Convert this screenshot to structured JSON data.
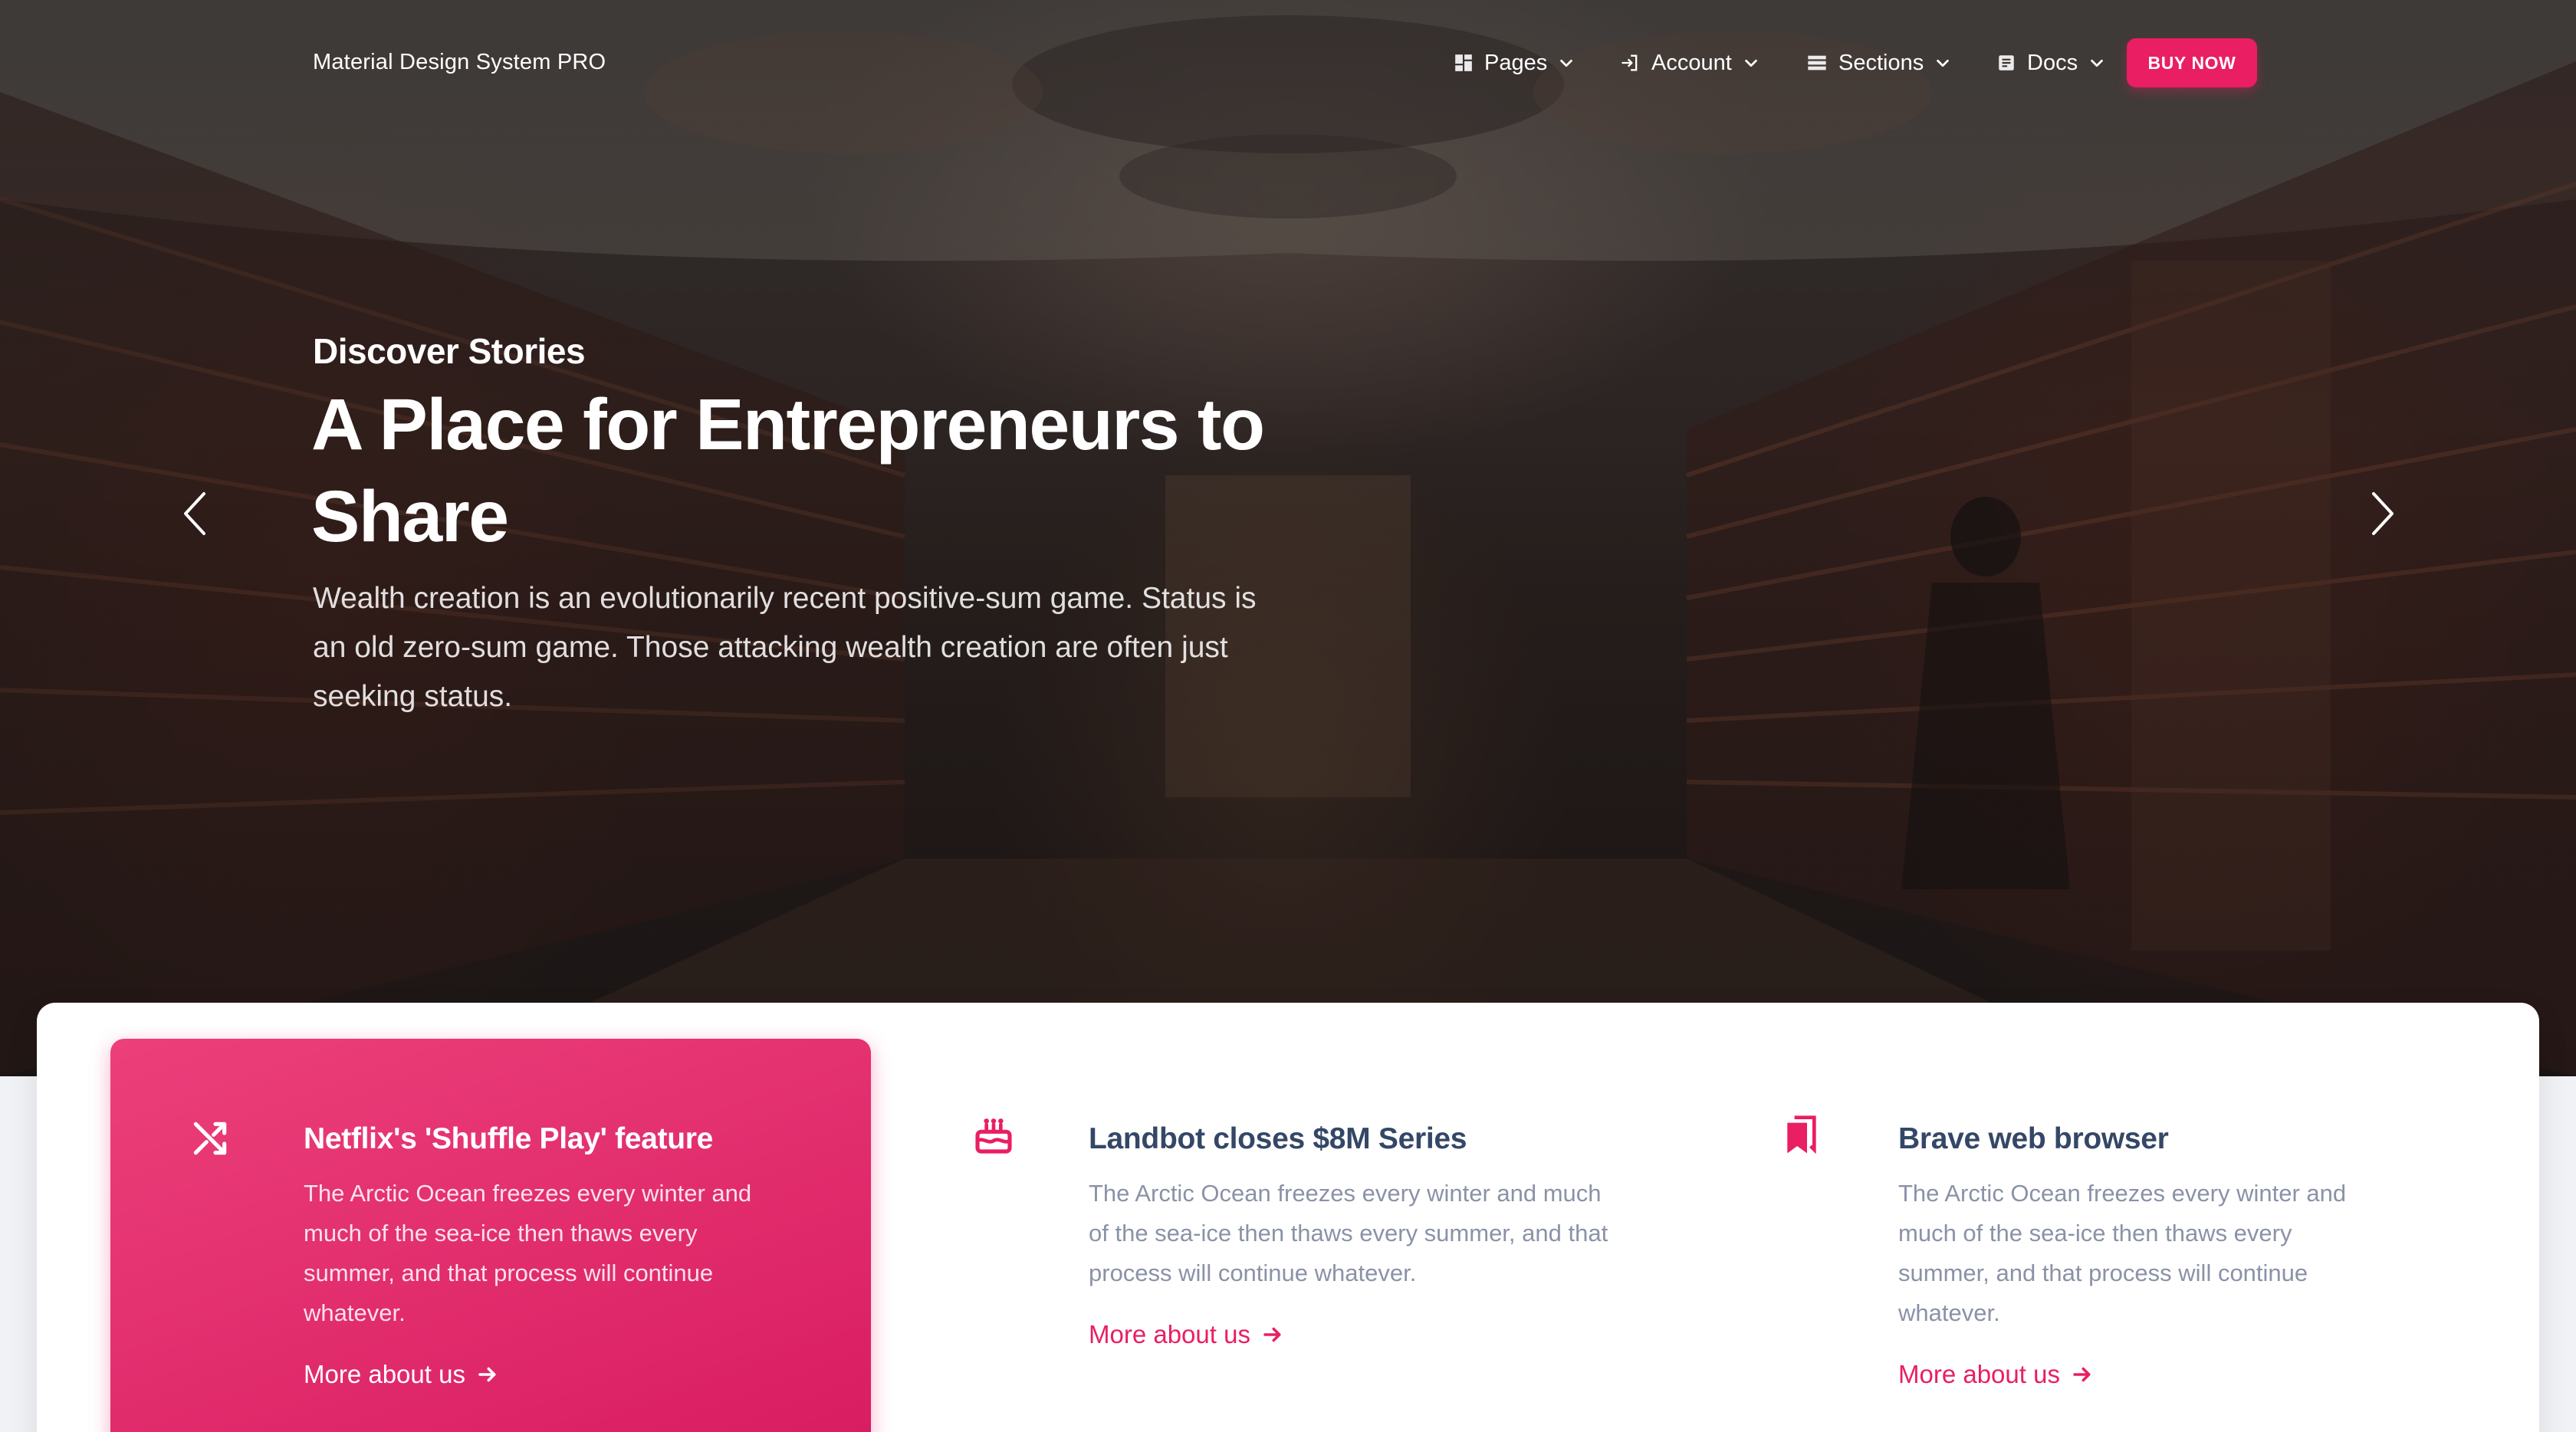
{
  "navbar": {
    "brand": "Material Design System PRO",
    "items": [
      {
        "label": "Pages",
        "icon": "dashboard-grid-icon"
      },
      {
        "label": "Account",
        "icon": "login-icon"
      },
      {
        "label": "Sections",
        "icon": "view-list-icon"
      },
      {
        "label": "Docs",
        "icon": "article-icon"
      }
    ],
    "cta_label": "BUY NOW"
  },
  "hero": {
    "eyebrow": "Discover Stories",
    "headline": "A Place for Entrepreneurs to Share",
    "lead": "Wealth creation is an evolutionarily recent positive-sum game. Status is an old zero-sum game. Those attacking wealth creation are often just seeking status.",
    "prev_icon": "chevron-left-icon",
    "next_icon": "chevron-right-icon"
  },
  "features": [
    {
      "icon": "shuffle-icon",
      "title": "Netflix's 'Shuffle Play' feature",
      "text": "The Arctic Ocean freezes every winter and much of the sea-ice then thaws every summer, and that process will continue whatever.",
      "link": "More about us"
    },
    {
      "icon": "cake-icon",
      "title": "Landbot closes $8M Series",
      "text": "The Arctic Ocean freezes every winter and much of the sea-ice then thaws every summer, and that process will continue whatever.",
      "link": "More about us"
    },
    {
      "icon": "bookmarks-icon",
      "title": "Brave web browser",
      "text": "The Arctic Ocean freezes every winter and much of the sea-ice then thaws every summer, and that process will continue whatever.",
      "link": "More about us"
    }
  ],
  "colors": {
    "accent": "#e91e63",
    "heading": "#344767",
    "body_text": "#8a92a6"
  }
}
